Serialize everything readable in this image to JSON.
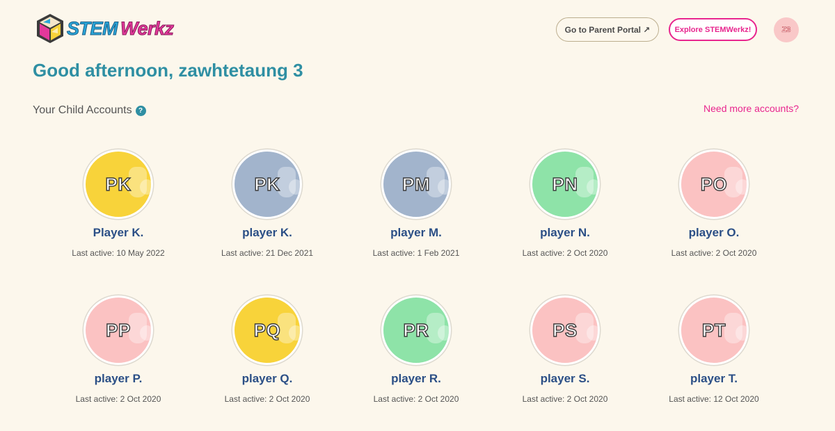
{
  "header": {
    "logo": {
      "part1": "STEM",
      "part2": "Werkz"
    },
    "portal_button": "Go to Parent Portal ↗",
    "explore_button": "Explore STEMWerkz!",
    "avatar_initials": "Z3"
  },
  "greeting": "Good afternoon, zawhtetaung 3",
  "section": {
    "title": "Your Child Accounts",
    "help": "?",
    "more_link": "Need more accounts?"
  },
  "colors": {
    "accent": "#2f8fa3",
    "pink": "#e8258e",
    "name": "#2b4f86",
    "yellow": "#f8d33a",
    "blue": "#a2b4cc",
    "green": "#8ee3a8",
    "rose": "#fbc2c2"
  },
  "accounts": [
    {
      "initials": "PK",
      "name": "Player K.",
      "last_active": "Last active: 10 May 2022",
      "color": "yellow"
    },
    {
      "initials": "PK",
      "name": "player K.",
      "last_active": "Last active: 21 Dec 2021",
      "color": "blue"
    },
    {
      "initials": "PM",
      "name": "player M.",
      "last_active": "Last active: 1 Feb 2021",
      "color": "blue"
    },
    {
      "initials": "PN",
      "name": "player N.",
      "last_active": "Last active: 2 Oct 2020",
      "color": "green"
    },
    {
      "initials": "PO",
      "name": "player O.",
      "last_active": "Last active: 2 Oct 2020",
      "color": "pink"
    },
    {
      "initials": "PP",
      "name": "player P.",
      "last_active": "Last active: 2 Oct 2020",
      "color": "pink"
    },
    {
      "initials": "PQ",
      "name": "player Q.",
      "last_active": "Last active: 2 Oct 2020",
      "color": "yellow"
    },
    {
      "initials": "PR",
      "name": "player R.",
      "last_active": "Last active: 2 Oct 2020",
      "color": "green"
    },
    {
      "initials": "PS",
      "name": "player S.",
      "last_active": "Last active: 2 Oct 2020",
      "color": "pink"
    },
    {
      "initials": "PT",
      "name": "player T.",
      "last_active": "Last active: 12 Oct 2020",
      "color": "pink"
    }
  ]
}
